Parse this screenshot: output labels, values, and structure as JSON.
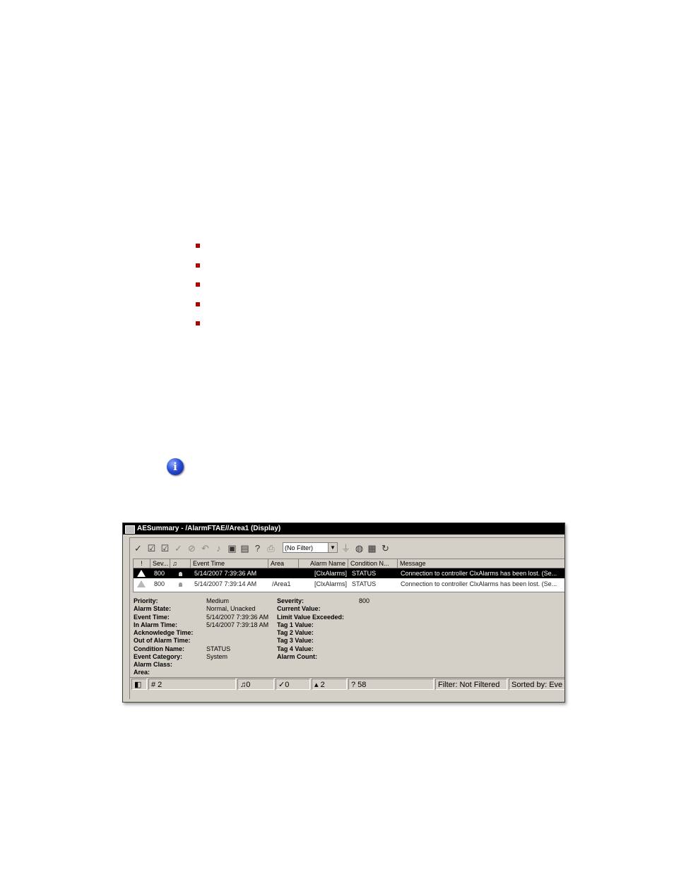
{
  "window": {
    "title": "AESummary - /AlarmFTAE//Area1 (Display)"
  },
  "toolbar": {
    "filter_value": "(No Filter)"
  },
  "grid": {
    "headers": [
      "!",
      "Sev...",
      "",
      "Event Time",
      "Area",
      "Alarm Name",
      "Condition N...",
      "Message"
    ],
    "rows": [
      {
        "sev": "800",
        "time": "5/14/2007 7:39:36 AM",
        "area": "",
        "alarm": "[ClxAlarms]",
        "cond": "STATUS",
        "msg": "Connection to controller ClxAlarms has been lost. (Se..."
      },
      {
        "sev": "800",
        "time": "5/14/2007 7:39:14 AM",
        "area": "/Area1",
        "alarm": "[ClxAlarms]",
        "cond": "STATUS",
        "msg": "Connection to controller ClxAlarms has been lost. (Se..."
      }
    ]
  },
  "details": {
    "left": [
      {
        "label": "Priority:",
        "value": "Medium"
      },
      {
        "label": "Alarm State:",
        "value": "Normal, Unacked"
      },
      {
        "label": "Event Time:",
        "value": "5/14/2007 7:39:36 AM"
      },
      {
        "label": "In Alarm Time:",
        "value": "5/14/2007 7:39:18 AM"
      },
      {
        "label": "Acknowledge Time:",
        "value": ""
      },
      {
        "label": "Out of Alarm Time:",
        "value": ""
      },
      {
        "label": "Condition Name:",
        "value": "STATUS"
      },
      {
        "label": "Event Category:",
        "value": "System"
      },
      {
        "label": "Alarm Class:",
        "value": ""
      },
      {
        "label": "Area:",
        "value": ""
      }
    ],
    "right": [
      {
        "label": "Severity:",
        "value": "800"
      },
      {
        "label": "Current Value:",
        "value": ""
      },
      {
        "label": "Limit Value Exceeded:",
        "value": ""
      },
      {
        "label": "Tag 1 Value:",
        "value": ""
      },
      {
        "label": "Tag 2 Value:",
        "value": ""
      },
      {
        "label": "Tag 3 Value:",
        "value": ""
      },
      {
        "label": "Tag 4 Value:",
        "value": ""
      },
      {
        "label": "Alarm Count:",
        "value": ""
      }
    ]
  },
  "statusbar": {
    "count": "# 2",
    "in_alarm": "0",
    "acked": "0",
    "unacked": "2",
    "unknown": "? 58",
    "filter": "Filter: Not Filtered",
    "sorted": "Sorted by: Eve"
  },
  "colors": {
    "bullet": "#b00000",
    "info_icon": "#2b4fd8",
    "window_face": "#d4d0c8"
  }
}
